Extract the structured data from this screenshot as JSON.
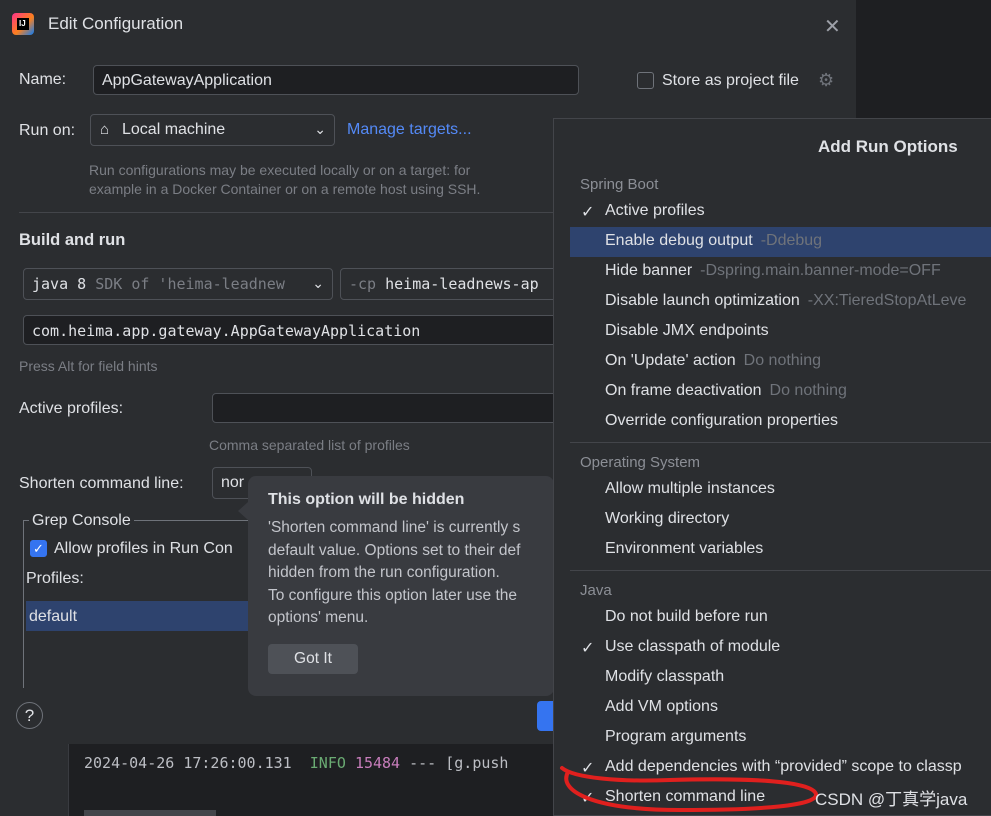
{
  "dialog": {
    "title": "Edit Configuration",
    "name_label": "Name:",
    "name_value": "AppGatewayApplication",
    "store_label": "Store as project file",
    "run_on_label": "Run on:",
    "run_on_value": "Local machine",
    "manage_targets": "Manage targets...",
    "run_on_hint_1": "Run configurations may be executed locally or on a target: for",
    "run_on_hint_2": "example in a Docker Container or on a remote host using SSH.",
    "build_and_run": "Build and run",
    "jdk_bold": "java 8",
    "jdk_rest": "SDK of 'heima-leadnew",
    "cp_flag": "-cp",
    "cp_value": "heima-leadnews-ap",
    "main_class": "com.heima.app.gateway.AppGatewayApplication",
    "field_hints": "Press Alt for field hints",
    "active_profiles_label": "Active profiles:",
    "profiles_hint": "Comma separated list of profiles",
    "shorten_label": "Shorten command line:",
    "shorten_value": "nor",
    "grep_console": "Grep Console",
    "allow_profiles": "Allow profiles in Run Con",
    "profiles_label": "Profiles:",
    "profile_item": "default",
    "help": "?"
  },
  "tooltip": {
    "title": "This option will be hidden",
    "lines": [
      "'Shorten command line' is currently s",
      "default value. Options set to their def",
      "hidden from the run configuration.",
      "To configure this option later use the",
      "options' menu."
    ],
    "button": "Got It"
  },
  "popup": {
    "title": "Add Run Options",
    "groups": [
      {
        "header": "Spring Boot",
        "items": [
          {
            "label": "Active profiles",
            "extra": "",
            "checked": true,
            "selected": false
          },
          {
            "label": "Enable debug output",
            "extra": "-Ddebug",
            "checked": false,
            "selected": true
          },
          {
            "label": "Hide banner",
            "extra": "-Dspring.main.banner-mode=OFF",
            "checked": false,
            "selected": false
          },
          {
            "label": "Disable launch optimization",
            "extra": "-XX:TieredStopAtLeve",
            "checked": false,
            "selected": false
          },
          {
            "label": "Disable JMX endpoints",
            "extra": "",
            "checked": false,
            "selected": false
          },
          {
            "label": "On 'Update' action",
            "extra": "Do nothing",
            "checked": false,
            "selected": false
          },
          {
            "label": "On frame deactivation",
            "extra": "Do nothing",
            "checked": false,
            "selected": false
          },
          {
            "label": "Override configuration properties",
            "extra": "",
            "checked": false,
            "selected": false
          }
        ]
      },
      {
        "header": "Operating System",
        "items": [
          {
            "label": "Allow multiple instances",
            "extra": "",
            "checked": false,
            "selected": false
          },
          {
            "label": "Working directory",
            "extra": "",
            "checked": false,
            "selected": false
          },
          {
            "label": "Environment variables",
            "extra": "",
            "checked": false,
            "selected": false
          }
        ]
      },
      {
        "header": "Java",
        "items": [
          {
            "label": "Do not build before run",
            "extra": "",
            "checked": false,
            "selected": false
          },
          {
            "label": "Use classpath of module",
            "extra": "",
            "checked": true,
            "selected": false
          },
          {
            "label": "Modify classpath",
            "extra": "",
            "checked": false,
            "selected": false
          },
          {
            "label": "Add VM options",
            "extra": "",
            "checked": false,
            "selected": false
          },
          {
            "label": "Program arguments",
            "extra": "",
            "checked": false,
            "selected": false
          },
          {
            "label": "Add dependencies with “provided” scope to classp",
            "extra": "",
            "checked": true,
            "selected": false
          },
          {
            "label": "Shorten command line",
            "extra": "",
            "checked": true,
            "selected": false
          }
        ]
      }
    ]
  },
  "console": {
    "timestamp": "2024-04-26 17:26:00.131",
    "level": "INFO",
    "pid": "15484",
    "rest": "--- [g.push"
  },
  "watermark": "CSDN @丁真学java",
  "colors": {
    "accent": "#3574f0",
    "selection": "#2e436e",
    "annotation": "#e0201e"
  }
}
